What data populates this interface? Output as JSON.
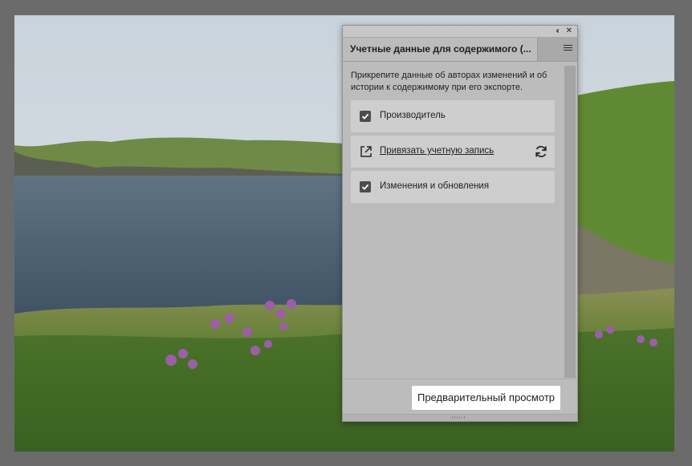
{
  "panel": {
    "title": "Учетные данные для содержимого (...",
    "description": "Прикрепите данные об авторах изменений и об истории к содержимому при его экспорте.",
    "items": [
      {
        "label": "Производитель",
        "type": "checkbox",
        "checked": true
      },
      {
        "label": "Привязать учетную запись",
        "type": "link",
        "icon": "external-link-icon",
        "action_icon": "refresh-icon"
      },
      {
        "label": "Изменения и обновления",
        "type": "checkbox",
        "checked": true
      }
    ],
    "preview_button": "Предварительный просмотр",
    "controls": {
      "collapse": "‹‹",
      "close": "✕"
    }
  },
  "colors": {
    "app_background": "#6b6b6b",
    "panel_background": "#bcbcbc",
    "item_background": "#cecece",
    "checkbox": "#4c4c4c",
    "button_background": "#ffffff"
  }
}
